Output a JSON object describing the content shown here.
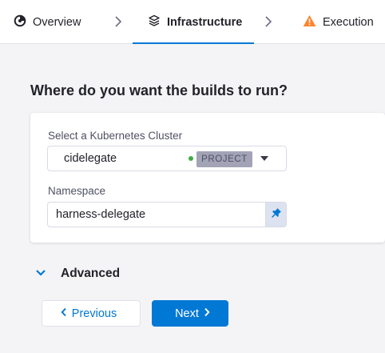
{
  "tabs": [
    {
      "label": "Overview",
      "icon": "overview-icon",
      "active": false
    },
    {
      "label": "Infrastructure",
      "icon": "infrastructure-icon",
      "active": true
    },
    {
      "label": "Execution",
      "icon": "warning-icon",
      "active": false
    }
  ],
  "colors": {
    "accent": "#0278d5",
    "warning": "#ff832b",
    "status_ok": "#42ab45",
    "badge_bg": "#a3a3b7"
  },
  "main": {
    "question": "Where do you want the builds to run?",
    "cluster": {
      "label": "Select a Kubernetes Cluster",
      "value": "cidelegate",
      "scope_badge": "PROJECT"
    },
    "namespace": {
      "label": "Namespace",
      "value": "harness-delegate"
    },
    "advanced_label": "Advanced"
  },
  "footer": {
    "previous_label": "Previous",
    "next_label": "Next"
  }
}
